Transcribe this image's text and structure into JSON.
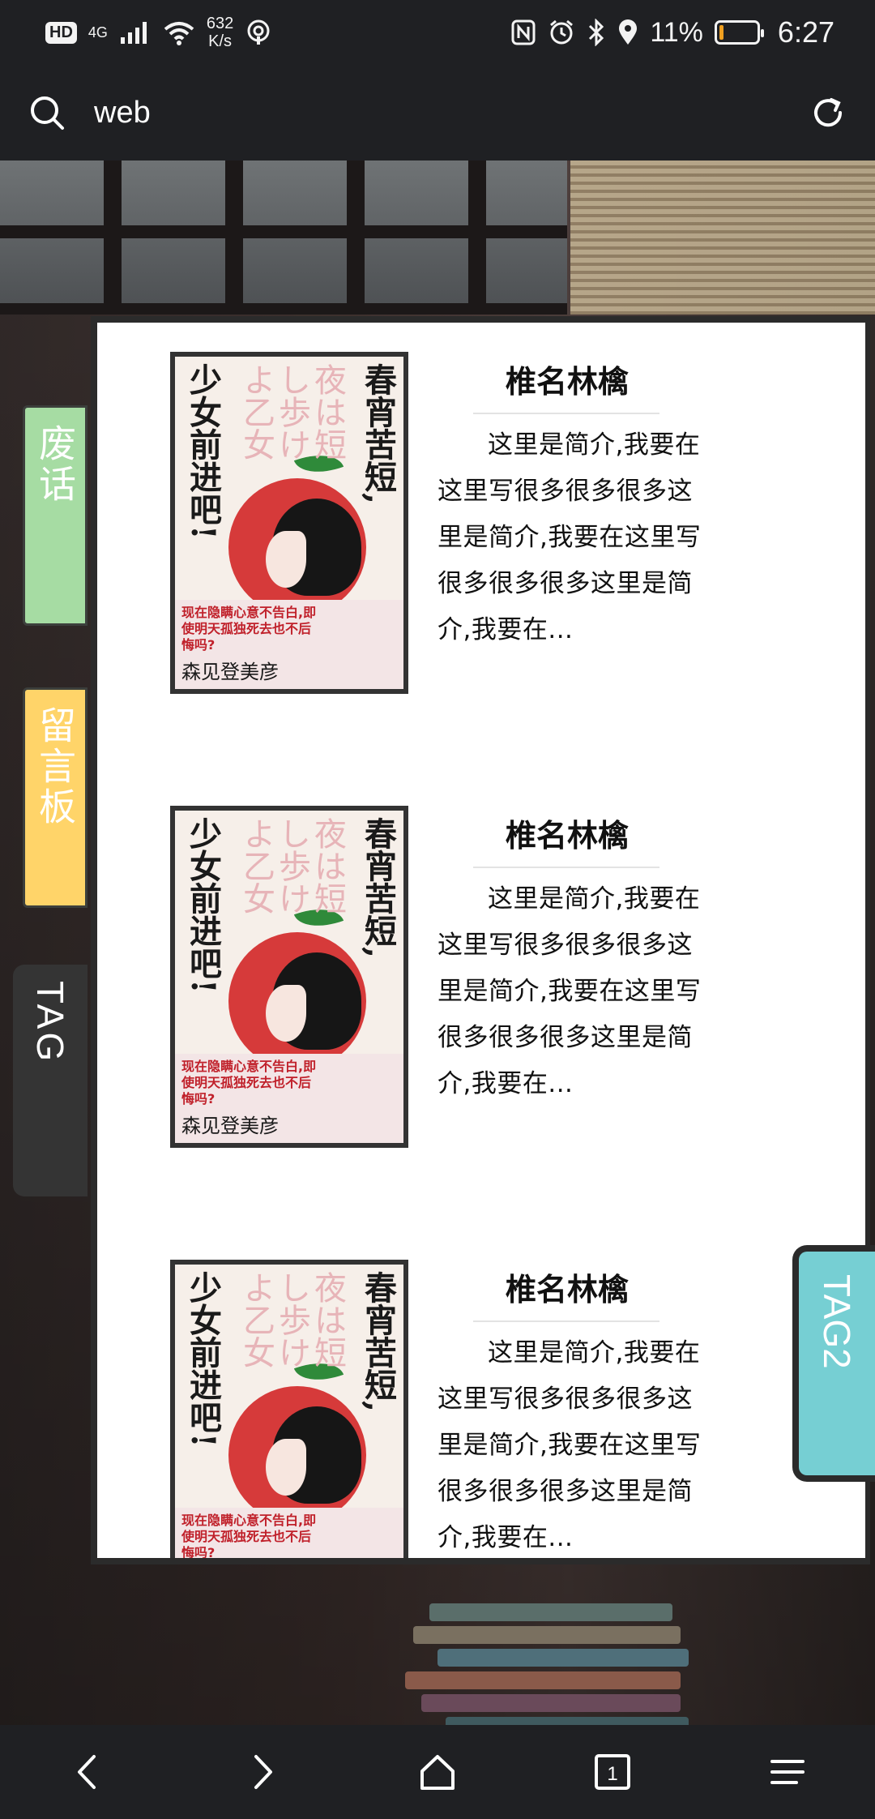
{
  "status_bar": {
    "hd": "HD",
    "network": "4G",
    "speed_value": "632",
    "speed_unit": "K/s",
    "battery_percent": "11%",
    "time": "6:27",
    "battery_level": 0.11,
    "battery_color": "#f0a020"
  },
  "browser": {
    "url": "web"
  },
  "side_tabs": {
    "tab1": "废话",
    "tab2": "留言板",
    "tab3": "TAG",
    "tab_right": "TAG2"
  },
  "cover": {
    "title_right": "春宵苦短,",
    "title_left": "少女前进吧!",
    "jp_text": "夜は短し歩けよ乙女",
    "red_text": "现在隐瞒心意不告白,即使明天孤独死去也不后悔吗?",
    "author": "森见登美彦"
  },
  "books": [
    {
      "title": "椎名林檎",
      "description": "这里是简介,我要在这里写很多很多很多这里是简介,我要在这里写很多很多很多这里是简介,我要在..."
    },
    {
      "title": "椎名林檎",
      "description": "这里是简介,我要在这里写很多很多很多这里是简介,我要在这里写很多很多很多这里是简介,我要在..."
    },
    {
      "title": "椎名林檎",
      "description": "这里是简介,我要在这里写很多很多很多这里是简介,我要在这里写很多很多很多这里是简介,我要在..."
    }
  ],
  "bottom_nav": {
    "tab_count": "1",
    "icons": [
      "back-icon",
      "forward-icon",
      "home-icon",
      "tabs-icon",
      "menu-icon"
    ]
  }
}
